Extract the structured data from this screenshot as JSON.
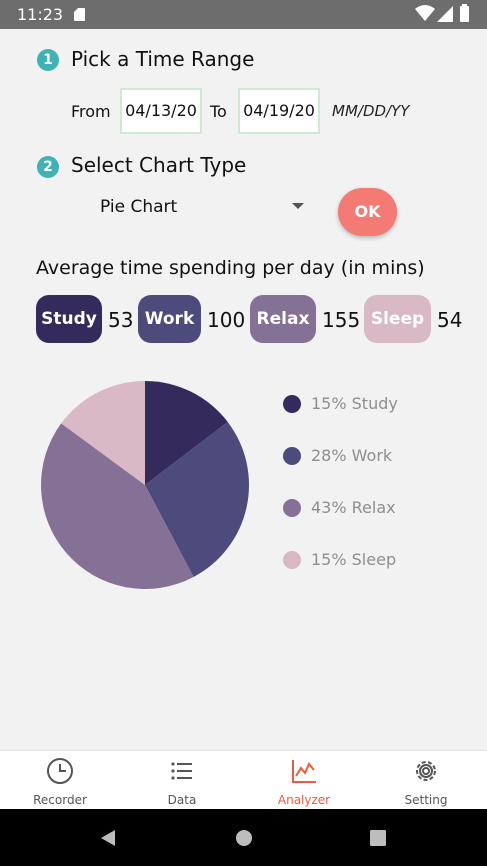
{
  "status_bar": {
    "time": "11:23",
    "icons": [
      "sd-card-icon",
      "wifi-icon",
      "signal-icon",
      "battery-icon"
    ]
  },
  "step1": {
    "number": "1",
    "title": "Pick a Time Range",
    "from_label": "From",
    "from_value": "04/13/20",
    "to_label": "To",
    "to_value": "04/19/20",
    "format_hint": "MM/DD/YY"
  },
  "step2": {
    "number": "2",
    "title": "Select Chart Type",
    "chart_type": "Pie Chart",
    "ok_label": "OK"
  },
  "averages": {
    "title": "Average time spending per day (in mins)",
    "items": [
      {
        "label": "Study",
        "value": "53",
        "color": "#352a5c"
      },
      {
        "label": "Work",
        "value": "100",
        "color": "#4d4a7c"
      },
      {
        "label": "Relax",
        "value": "155",
        "color": "#857096"
      },
      {
        "label": "Sleep",
        "value": "54",
        "color": "#d8b9c5"
      }
    ]
  },
  "chart_data": {
    "type": "pie",
    "slices": [
      {
        "label": "Study",
        "value": 53,
        "percent_label": "15%",
        "color": "#352a5c"
      },
      {
        "label": "Work",
        "value": 100,
        "percent_label": "28%",
        "color": "#4d4a7c"
      },
      {
        "label": "Relax",
        "value": 155,
        "percent_label": "43%",
        "color": "#857096"
      },
      {
        "label": "Sleep",
        "value": 54,
        "percent_label": "15%",
        "color": "#d8b9c5"
      }
    ],
    "legend": {
      "placement": "right",
      "entries": [
        "15% Study",
        "28% Work",
        "43% Relax",
        "15% Sleep"
      ]
    }
  },
  "bottom_nav": {
    "items": [
      {
        "label": "Recorder",
        "icon": "clock-icon",
        "active": false
      },
      {
        "label": "Data",
        "icon": "list-icon",
        "active": false
      },
      {
        "label": "Analyzer",
        "icon": "chart-icon",
        "active": true
      },
      {
        "label": "Setting",
        "icon": "gear-icon",
        "active": false
      }
    ],
    "active_color": "#f05a3a"
  },
  "system_nav": {
    "icons": [
      "back-icon",
      "home-icon",
      "recents-icon"
    ]
  }
}
